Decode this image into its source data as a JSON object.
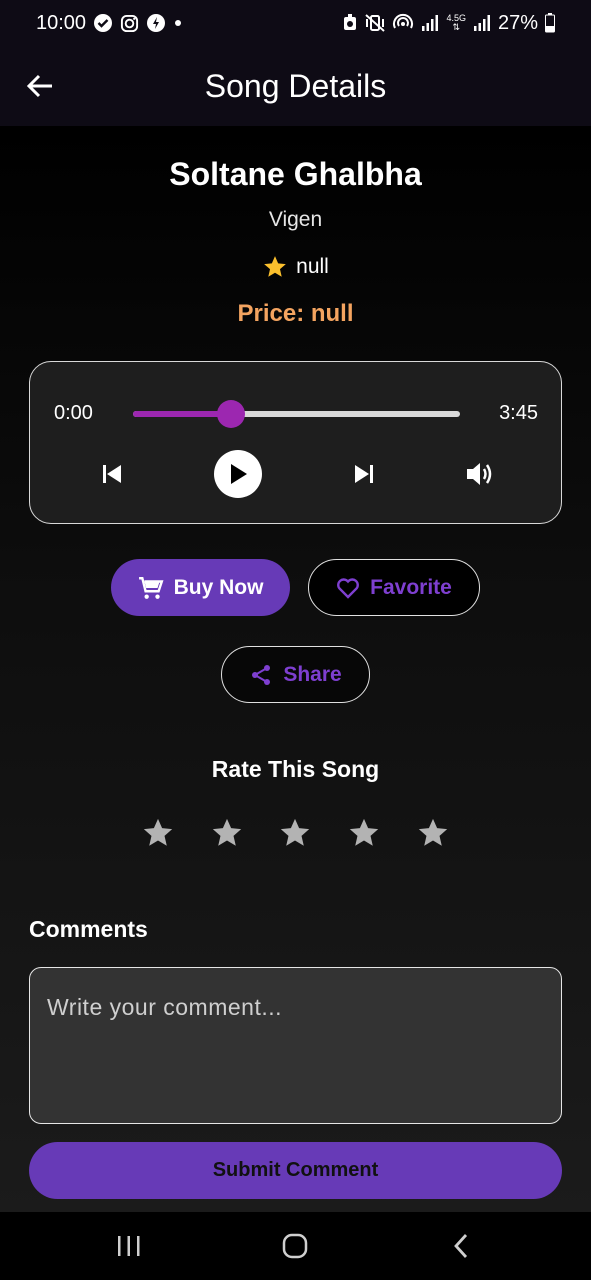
{
  "status_bar": {
    "time": "10:00",
    "battery": "27%",
    "network": "4.5G",
    "left_icons": [
      "shield-check-icon",
      "instagram-icon",
      "app-badge-icon",
      "dot-icon"
    ],
    "right_icons": [
      "alarm-icon",
      "vibrate-mute-icon",
      "hotspot-icon",
      "signal-icon",
      "signal-icon",
      "battery-icon"
    ]
  },
  "app_bar": {
    "title": "Song Details",
    "back_icon": "arrow-left-icon"
  },
  "song": {
    "title": "Soltane Ghalbha",
    "artist": "Vigen",
    "rating": "null",
    "price": "Price: null"
  },
  "player": {
    "current_time": "0:00",
    "total_time": "3:45",
    "progress": 0.3,
    "controls": [
      "skip-previous-icon",
      "play-icon",
      "skip-next-icon",
      "volume-icon"
    ]
  },
  "actions": {
    "buy_label": "Buy Now",
    "favorite_label": "Favorite",
    "share_label": "Share"
  },
  "rate": {
    "title": "Rate This Song",
    "stars_total": 5,
    "stars_selected": 0
  },
  "comments": {
    "label": "Comments",
    "placeholder": "Write your comment...",
    "submit_label": "Submit Comment"
  },
  "colors": {
    "accent": "#673ab7",
    "slider": "#9c27b0",
    "price": "#f4a460",
    "star": "#fbc02d"
  }
}
